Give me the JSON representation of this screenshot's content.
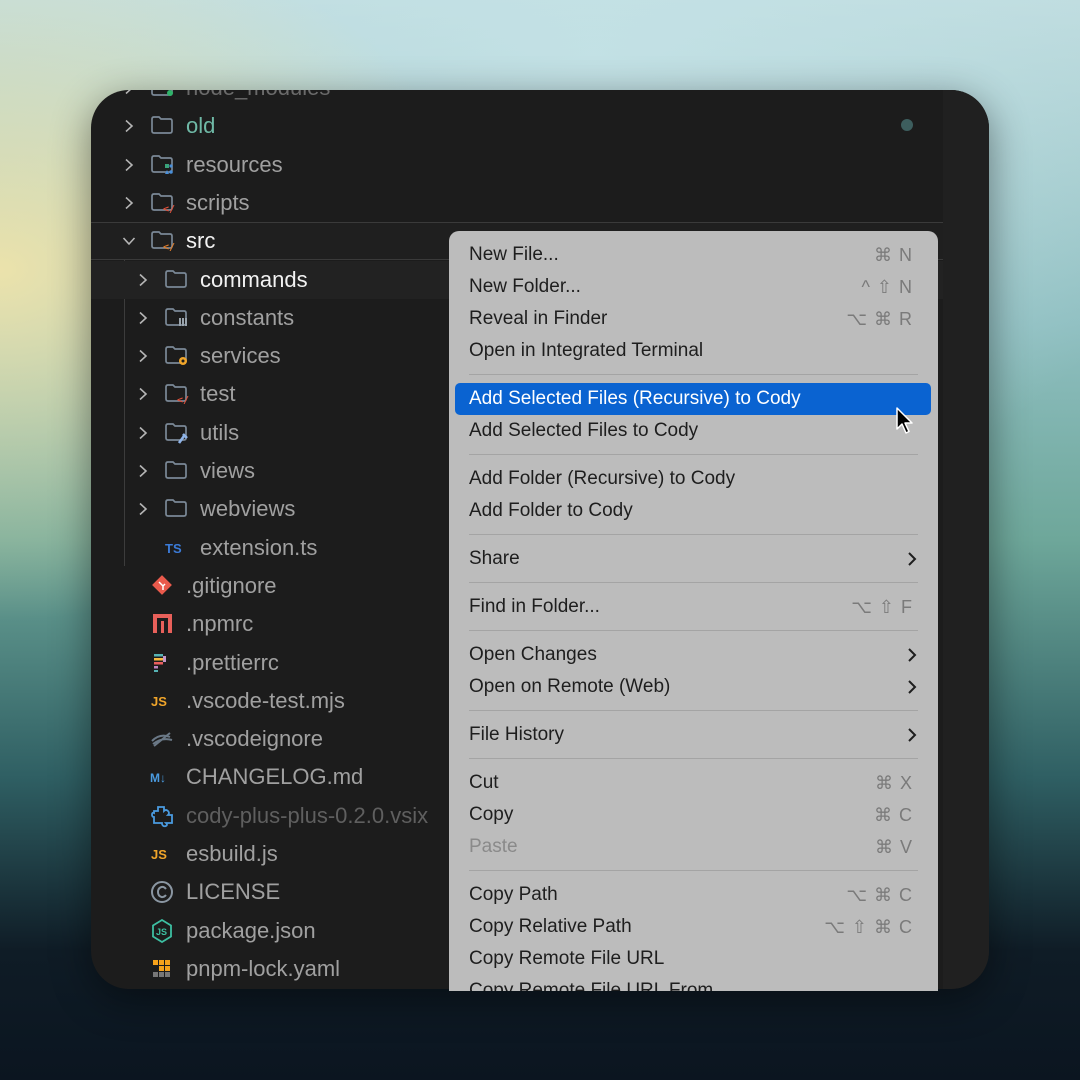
{
  "explorer": {
    "items": [
      {
        "name": "node_modules",
        "type": "folder",
        "expanded": false,
        "level": 0,
        "partial": true
      },
      {
        "name": "old",
        "type": "folder",
        "expanded": false,
        "level": 0,
        "color": "#6fb9a6",
        "modified": true
      },
      {
        "name": "resources",
        "type": "folder",
        "expanded": false,
        "level": 0
      },
      {
        "name": "scripts",
        "type": "folder",
        "expanded": false,
        "level": 0
      },
      {
        "name": "src",
        "type": "folder",
        "expanded": true,
        "level": 0
      },
      {
        "name": "commands",
        "type": "folder",
        "expanded": false,
        "level": 1
      },
      {
        "name": "constants",
        "type": "folder",
        "expanded": false,
        "level": 1
      },
      {
        "name": "services",
        "type": "folder",
        "expanded": false,
        "level": 1
      },
      {
        "name": "test",
        "type": "folder",
        "expanded": false,
        "level": 1
      },
      {
        "name": "utils",
        "type": "folder",
        "expanded": false,
        "level": 1
      },
      {
        "name": "views",
        "type": "folder",
        "expanded": false,
        "level": 1
      },
      {
        "name": "webviews",
        "type": "folder",
        "expanded": false,
        "level": 1
      },
      {
        "name": "extension.ts",
        "type": "file",
        "level": 1,
        "icon_text": "TS"
      },
      {
        "name": ".gitignore",
        "type": "file",
        "level": 0
      },
      {
        "name": ".npmrc",
        "type": "file",
        "level": 0
      },
      {
        "name": ".prettierrc",
        "type": "file",
        "level": 0
      },
      {
        "name": ".vscode-test.mjs",
        "type": "file",
        "level": 0,
        "icon_text": "JS"
      },
      {
        "name": ".vscodeignore",
        "type": "file",
        "level": 0
      },
      {
        "name": "CHANGELOG.md",
        "type": "file",
        "level": 0,
        "icon_text": "M↓"
      },
      {
        "name": "cody-plus-plus-0.2.0.vsix",
        "type": "file",
        "level": 0,
        "dimmed": true
      },
      {
        "name": "esbuild.js",
        "type": "file",
        "level": 0,
        "icon_text": "JS"
      },
      {
        "name": "LICENSE",
        "type": "file",
        "level": 0
      },
      {
        "name": "package.json",
        "type": "file",
        "level": 0
      },
      {
        "name": "pnpm-lock.yaml",
        "type": "file",
        "level": 0
      }
    ]
  },
  "context_menu": {
    "groups": [
      [
        {
          "label": "New File...",
          "shortcut": "⌘ N"
        },
        {
          "label": "New Folder...",
          "shortcut": "^ ⇧ N"
        },
        {
          "label": "Reveal in Finder",
          "shortcut": "⌥ ⌘ R"
        },
        {
          "label": "Open in Integrated Terminal",
          "shortcut": ""
        }
      ],
      [
        {
          "label": "Add Selected Files (Recursive) to Cody",
          "shortcut": "",
          "active": true
        },
        {
          "label": "Add Selected Files to Cody",
          "shortcut": ""
        }
      ],
      [
        {
          "label": "Add Folder (Recursive) to Cody",
          "shortcut": ""
        },
        {
          "label": "Add Folder to Cody",
          "shortcut": ""
        }
      ],
      [
        {
          "label": "Share",
          "submenu": true
        }
      ],
      [
        {
          "label": "Find in Folder...",
          "shortcut": "⌥ ⇧ F"
        }
      ],
      [
        {
          "label": "Open Changes",
          "submenu": true
        },
        {
          "label": "Open on Remote (Web)",
          "submenu": true
        }
      ],
      [
        {
          "label": "File History",
          "submenu": true
        }
      ],
      [
        {
          "label": "Cut",
          "shortcut": "⌘ X"
        },
        {
          "label": "Copy",
          "shortcut": "⌘ C"
        },
        {
          "label": "Paste",
          "shortcut": "⌘ V",
          "disabled": true
        }
      ],
      [
        {
          "label": "Copy Path",
          "shortcut": "⌥ ⌘ C"
        },
        {
          "label": "Copy Relative Path",
          "shortcut": "⌥ ⇧ ⌘ C"
        },
        {
          "label": "Copy Remote File URL",
          "shortcut": ""
        },
        {
          "label": "Copy Remote File URL From",
          "shortcut": "",
          "partial": true
        }
      ]
    ]
  },
  "colors": {
    "accent": "#0a63d1",
    "menu_bg": "#bcbcbc",
    "panel_bg": "#1c1c1c"
  }
}
